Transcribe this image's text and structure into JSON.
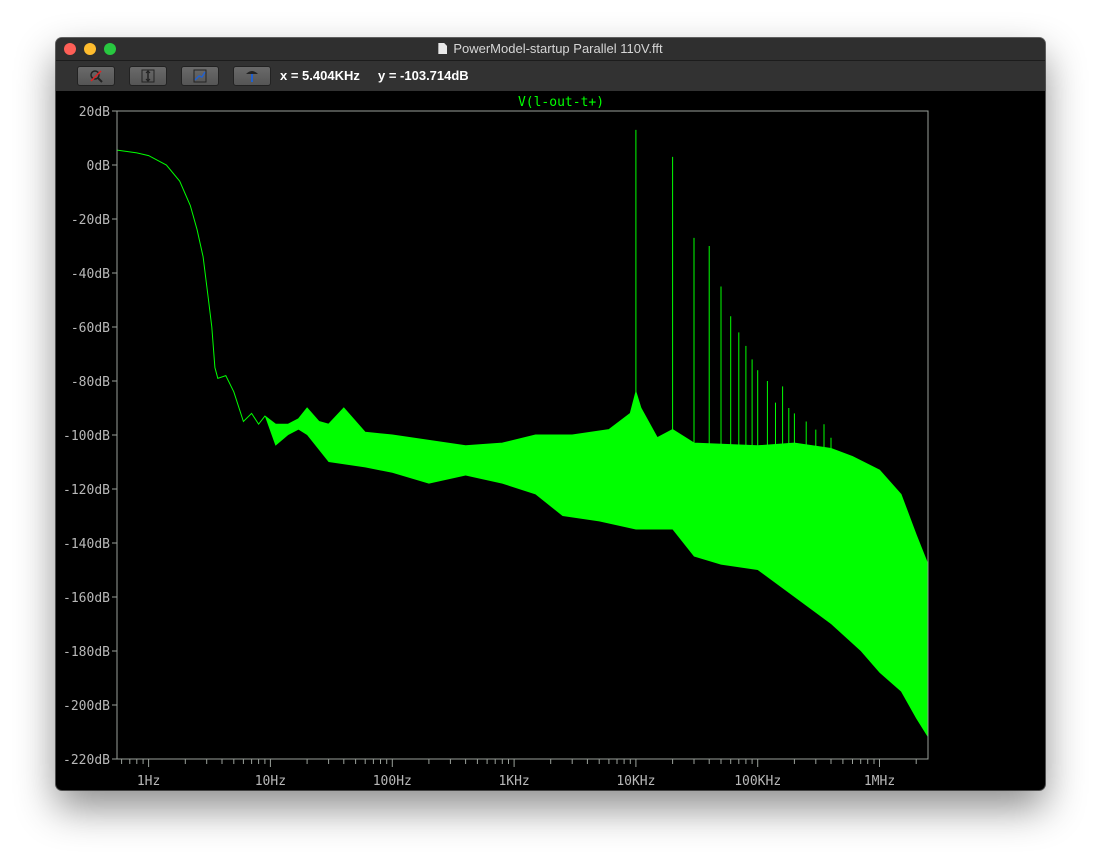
{
  "window": {
    "title": "PowerModel-startup Parallel 110V.fft"
  },
  "toolbar": {
    "buttons": [
      {
        "icon": "zoom-icon"
      },
      {
        "icon": "autorange-icon"
      },
      {
        "icon": "pan-icon"
      },
      {
        "icon": "probe-icon"
      }
    ],
    "cursor_x": "x = 5.404KHz",
    "cursor_y": "y = -103.714dB"
  },
  "colors": {
    "trace": "#00ff00",
    "axis": "#9aa09a",
    "background": "#000000"
  },
  "chart_data": {
    "type": "line",
    "title": "V(l-out-t+)",
    "xscale": "log",
    "xlim": [
      0.55,
      2500000
    ],
    "ylim": [
      -220,
      20
    ],
    "x_ticks": [
      "1Hz",
      "10Hz",
      "100Hz",
      "1KHz",
      "10KHz",
      "100KHz",
      "1MHz"
    ],
    "y_ticks": [
      "20dB",
      "0dB",
      "-20dB",
      "-40dB",
      "-60dB",
      "-80dB",
      "-100dB",
      "-120dB",
      "-140dB",
      "-160dB",
      "-180dB",
      "-200dB",
      "-220dB"
    ],
    "grid": false,
    "series": [
      {
        "name": "V(l-out-t+)",
        "envelope_upper": [
          [
            0.55,
            5.5
          ],
          [
            0.8,
            4.5
          ],
          [
            1,
            3.5
          ],
          [
            1.4,
            0
          ],
          [
            1.8,
            -6
          ],
          [
            2.2,
            -15
          ],
          [
            2.5,
            -24
          ],
          [
            2.8,
            -34
          ],
          [
            3.1,
            -50
          ],
          [
            3.3,
            -60
          ],
          [
            3.5,
            -75
          ],
          [
            3.7,
            -79
          ],
          [
            4.3,
            -78
          ],
          [
            5,
            -84
          ],
          [
            6,
            -95
          ],
          [
            7,
            -92
          ],
          [
            8,
            -96
          ],
          [
            9,
            -93
          ],
          [
            11,
            -96
          ],
          [
            14,
            -96
          ],
          [
            17,
            -94
          ],
          [
            20,
            -90
          ],
          [
            25,
            -95
          ],
          [
            30,
            -96
          ],
          [
            40,
            -90
          ],
          [
            60,
            -99
          ],
          [
            100,
            -100
          ],
          [
            200,
            -102
          ],
          [
            400,
            -104
          ],
          [
            800,
            -103
          ],
          [
            1500,
            -100
          ],
          [
            3000,
            -100
          ],
          [
            6000,
            -98
          ],
          [
            9000,
            -92
          ],
          [
            10000,
            -84
          ],
          [
            11000,
            -90
          ],
          [
            15000,
            -101
          ],
          [
            20000,
            -98
          ],
          [
            30000,
            -103
          ],
          [
            100000,
            -104
          ],
          [
            200000,
            -103
          ],
          [
            400000,
            -105
          ],
          [
            600000,
            -108
          ],
          [
            1000000,
            -113
          ],
          [
            1500000,
            -122
          ],
          [
            2000000,
            -137
          ],
          [
            2500000,
            -148
          ]
        ],
        "envelope_lower": [
          [
            0.55,
            5.5
          ],
          [
            0.8,
            4.5
          ],
          [
            1,
            3.5
          ],
          [
            1.4,
            0
          ],
          [
            1.8,
            -6
          ],
          [
            2.2,
            -15
          ],
          [
            2.5,
            -24
          ],
          [
            2.8,
            -34
          ],
          [
            3.1,
            -50
          ],
          [
            3.3,
            -60
          ],
          [
            3.5,
            -75
          ],
          [
            3.7,
            -79
          ],
          [
            4.3,
            -78
          ],
          [
            5,
            -84
          ],
          [
            6,
            -95
          ],
          [
            7,
            -92
          ],
          [
            8,
            -96
          ],
          [
            9,
            -93
          ],
          [
            11,
            -104
          ],
          [
            14,
            -100
          ],
          [
            17,
            -98
          ],
          [
            20,
            -100
          ],
          [
            30,
            -110
          ],
          [
            60,
            -112
          ],
          [
            100,
            -114
          ],
          [
            200,
            -118
          ],
          [
            400,
            -115
          ],
          [
            800,
            -118
          ],
          [
            1500,
            -122
          ],
          [
            2500,
            -130
          ],
          [
            5000,
            -132
          ],
          [
            10000,
            -135
          ],
          [
            20000,
            -135
          ],
          [
            30000,
            -145
          ],
          [
            50000,
            -148
          ],
          [
            100000,
            -150
          ],
          [
            200000,
            -160
          ],
          [
            400000,
            -170
          ],
          [
            700000,
            -180
          ],
          [
            1000000,
            -188
          ],
          [
            1500000,
            -195
          ],
          [
            2000000,
            -205
          ],
          [
            2500000,
            -212
          ]
        ],
        "spikes": [
          [
            10000,
            13
          ],
          [
            20000,
            3
          ],
          [
            30000,
            -27
          ],
          [
            40000,
            -30
          ],
          [
            50000,
            -45
          ],
          [
            60000,
            -56
          ],
          [
            70000,
            -62
          ],
          [
            80000,
            -67
          ],
          [
            90000,
            -72
          ],
          [
            100000,
            -76
          ],
          [
            120000,
            -80
          ],
          [
            140000,
            -88
          ],
          [
            160000,
            -82
          ],
          [
            180000,
            -90
          ],
          [
            200000,
            -92
          ],
          [
            250000,
            -95
          ],
          [
            300000,
            -98
          ],
          [
            350000,
            -96
          ],
          [
            400000,
            -101
          ],
          [
            500000,
            -108
          ]
        ]
      }
    ]
  }
}
